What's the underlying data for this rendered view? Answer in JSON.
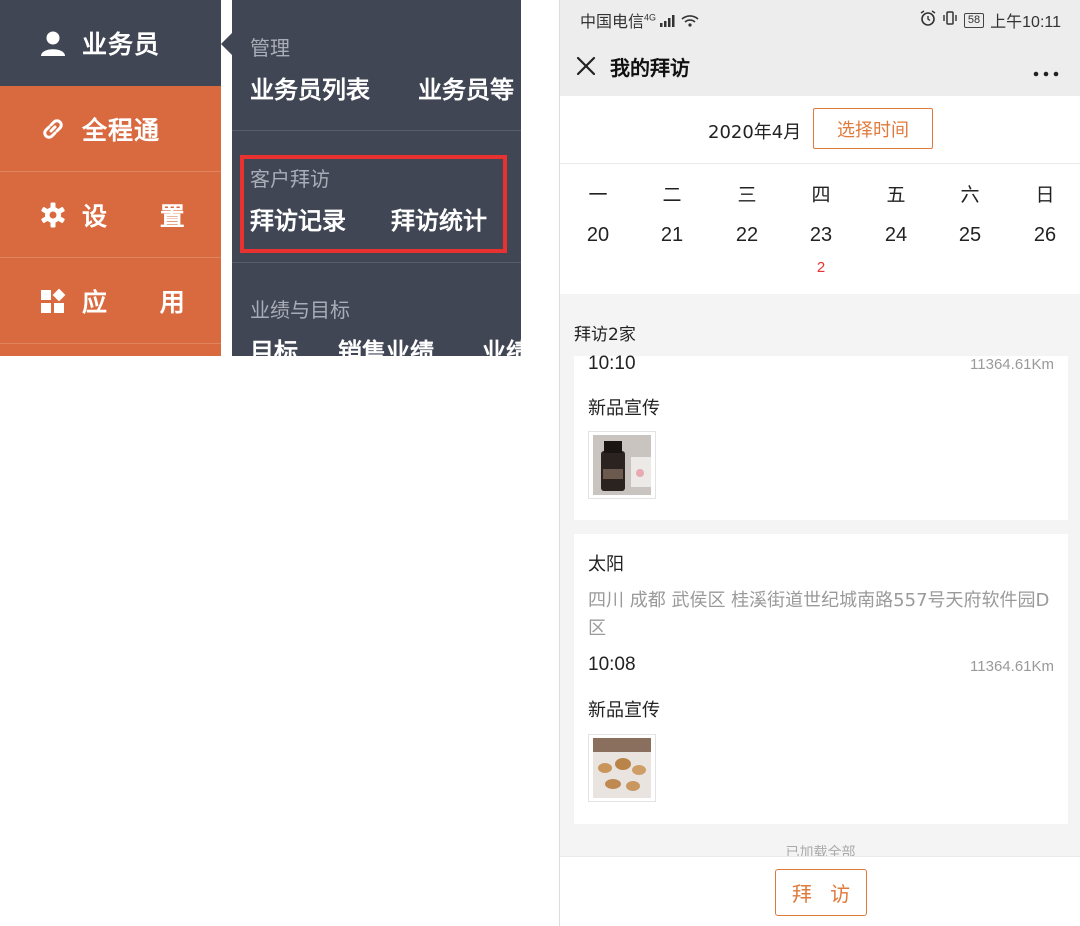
{
  "admin_menu": {
    "nav": [
      {
        "label": "业务员",
        "icon": "user-icon",
        "active": true
      },
      {
        "label": "全程通",
        "icon": "link-icon",
        "active": false
      },
      {
        "label": "设 置",
        "icon": "gear-icon",
        "active": false
      },
      {
        "label": "应 用",
        "icon": "apps-icon",
        "active": false
      }
    ],
    "submenu": {
      "sections": [
        {
          "title": "管理",
          "links": [
            "业务员列表",
            "业务员等"
          ]
        },
        {
          "title": "客户拜访",
          "links": [
            "拜访记录",
            "拜访统计"
          ]
        },
        {
          "title": "业绩与目标",
          "links": [
            "目标",
            "销售业绩",
            "业绩"
          ]
        }
      ]
    },
    "colors": {
      "nav_bg": "#d9693e",
      "active_bg": "#414654",
      "highlight": "#e8322f"
    }
  },
  "phone": {
    "status_bar": {
      "carrier": "中国电信",
      "network": "4G",
      "battery": "58",
      "time": "上午10:11"
    },
    "title": "我的拜访",
    "month": {
      "label": "2020年4月",
      "pick_button": "选择时间"
    },
    "calendar": {
      "weekdays": [
        "一",
        "二",
        "三",
        "四",
        "五",
        "六",
        "日"
      ],
      "dates": [
        "20",
        "21",
        "22",
        "23",
        "24",
        "25",
        "26"
      ],
      "marked_count": "2"
    },
    "summary": "拜访2家",
    "visits": [
      {
        "time": "10:10",
        "distance": "11364.61Km",
        "purpose": "新品宣传",
        "thumb": "bottle-photo-icon"
      },
      {
        "name": "太阳",
        "address": "四川 成都 武侯区 桂溪街道世纪城南路557号天府软件园D区",
        "time": "10:08",
        "distance": "11364.61Km",
        "purpose": "新品宣传",
        "thumb": "food-photo-icon"
      }
    ],
    "footer_note": "已加载全部",
    "visit_button": "拜 访",
    "colors": {
      "accent": "#e07a3c",
      "mark": "#e8322f"
    }
  }
}
